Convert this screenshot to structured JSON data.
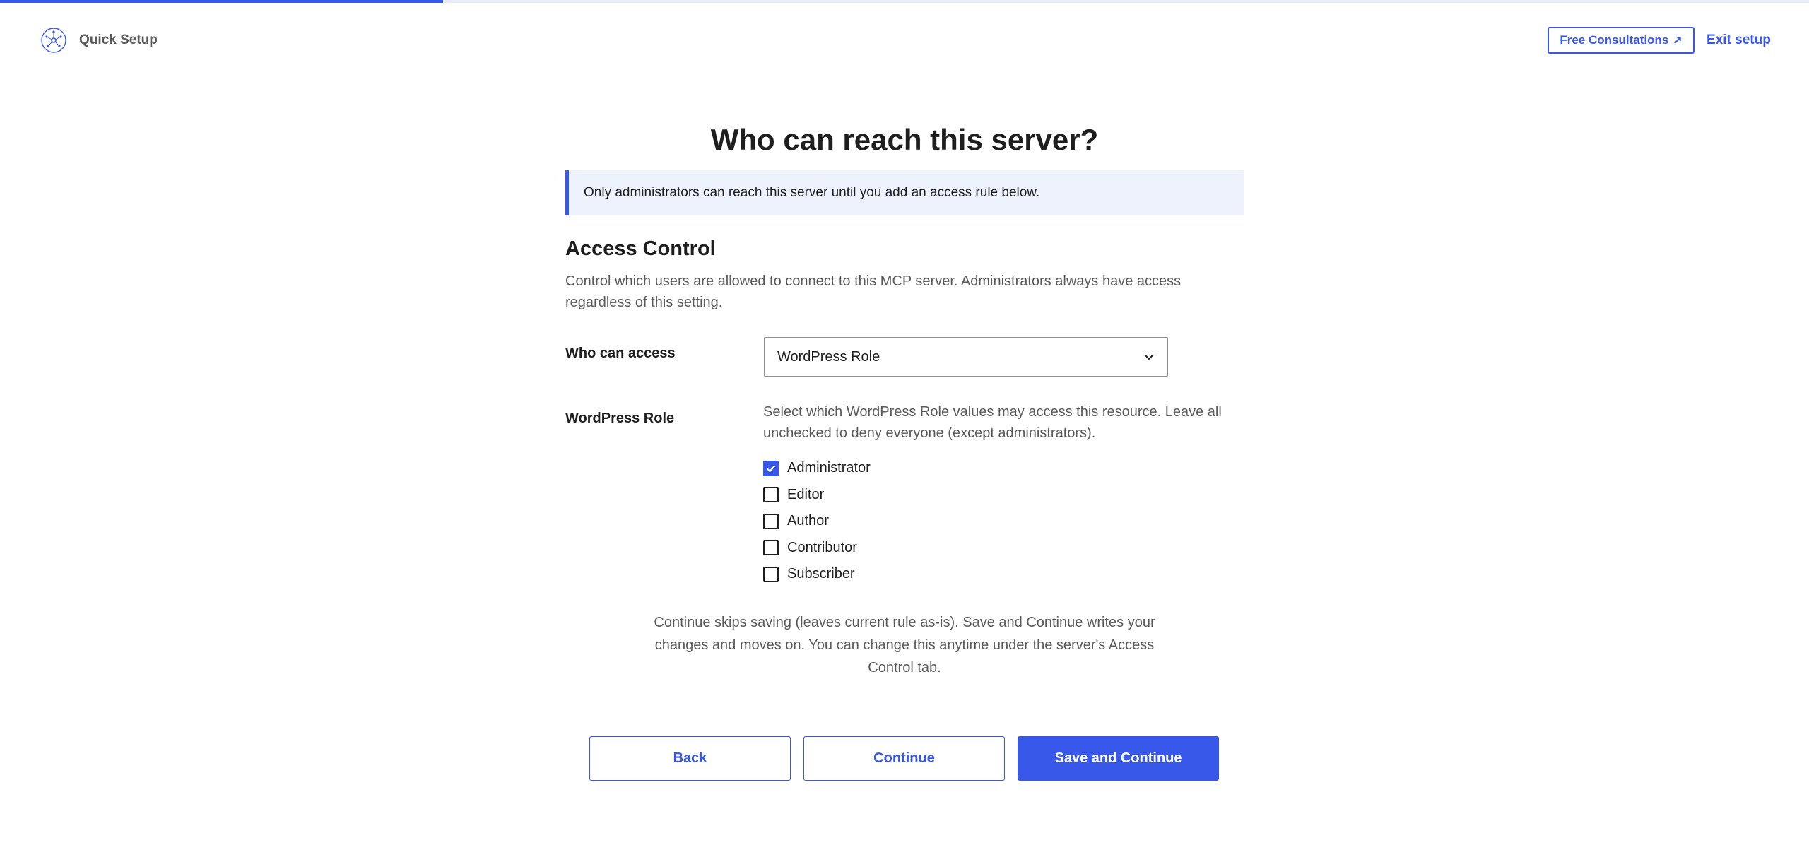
{
  "progress": {
    "fraction": 0.245,
    "color": "#3858e9"
  },
  "header": {
    "logo_icon": "network-nodes-icon",
    "title": "Quick Setup",
    "consult_label": "Free Consultations",
    "consult_arrow": "↗",
    "exit_label": "Exit setup"
  },
  "main": {
    "title": "Who can reach this server?",
    "notice": "Only administrators can reach this server until you add an access rule below.",
    "section_title": "Access Control",
    "section_desc": "Control which users are allowed to connect to this MCP server. Administrators always have access regardless of this setting.",
    "access_label": "Who can access",
    "access_select_value": "WordPress Role",
    "role_label": "WordPress Role",
    "role_help": "Select which WordPress Role values may access this resource. Leave all unchecked to deny everyone (except administrators).",
    "roles": [
      {
        "label": "Administrator",
        "checked": true
      },
      {
        "label": "Editor",
        "checked": false
      },
      {
        "label": "Author",
        "checked": false
      },
      {
        "label": "Contributor",
        "checked": false
      },
      {
        "label": "Subscriber",
        "checked": false
      }
    ],
    "footnote": "Continue skips saving (leaves current rule as-is). Save and Continue writes your changes and moves on. You can change this anytime under the server's Access Control tab."
  },
  "actions": {
    "back_label": "Back",
    "continue_label": "Continue",
    "save_label": "Save and Continue"
  },
  "colors": {
    "accent": "#3858e9",
    "notice_bg": "#eef2fd",
    "muted_text": "#5a5a5a"
  }
}
